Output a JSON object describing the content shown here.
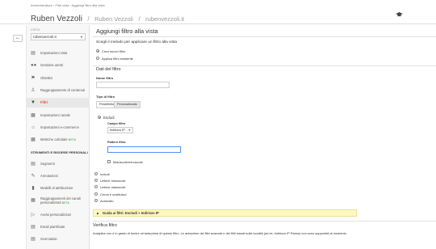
{
  "header": {
    "breadcrumb": "Amministratore › Filtri vista › Aggiungi filtro alla vista",
    "title": "Ruben Vezzoli",
    "subtitle_a": "Ruben Vezzoli",
    "subtitle_b": "rubenvezzoli.it"
  },
  "sidebar": {
    "vista_label": "VISTA",
    "vista_value": "rubenvezzoli.it",
    "section_personal": "STRUMENTI E RISORSE PERSONALI",
    "items": [
      {
        "label": "Impostazioni vista",
        "icon": "document-icon"
      },
      {
        "label": "Gestione utenti",
        "icon": "users-icon"
      },
      {
        "label": "Obiettivi",
        "icon": "flag-icon"
      },
      {
        "label": "Raggruppamento di contenuti",
        "icon": "person-icon"
      },
      {
        "label": "Filtri",
        "icon": "filter-icon"
      },
      {
        "label": "Impostazioni canale",
        "icon": "channel-icon"
      },
      {
        "label": "Impostazioni e-commerce",
        "icon": "cart-icon"
      },
      {
        "label": "Metriche calcolate",
        "badge": "BETA",
        "icon": "calc-icon"
      },
      {
        "label": "Segmenti",
        "icon": "segments-icon"
      },
      {
        "label": "Annotazioni",
        "icon": "annotation-icon"
      },
      {
        "label": "Modelli di attribuzione",
        "icon": "bars-icon"
      },
      {
        "label": "Raggruppamenti dei canali",
        "label2": "personalizzati",
        "badge": "BETA",
        "icon": "grid-icon"
      },
      {
        "label": "Avvisi personalizzati",
        "icon": "megaphone-icon"
      },
      {
        "label": "Email pianificate",
        "icon": "calendar-icon"
      },
      {
        "label": "Scorciatoie",
        "icon": "shortcut-icon"
      }
    ]
  },
  "main": {
    "title": "Aggiungi filtro alla vista",
    "method_prompt": "Scegli il metodo per applicare un filtro alla vista",
    "method_new": "Crea nuovo filtro",
    "method_existing": "Applica filtro esistente",
    "details_title": "Dati del filtro",
    "name_label": "Nome filtro",
    "name_value": "",
    "type_label": "Tipo di filtro",
    "type_predefined": "Predefinito",
    "type_custom": "Personalizzato",
    "exclude_label": "Escludi",
    "field_label": "Campo filtro",
    "field_value": "Indirizzo IP",
    "pattern_label": "Pattern filtro",
    "pattern_value": "",
    "case_label": "Maiuscole/minuscole",
    "options": [
      "Includi",
      "Lettere minuscole",
      "Lettere maiuscole",
      "Cerca e sostituisci",
      "Avanzato"
    ],
    "guide_prefix": "Guida ai filtri:",
    "guide_path": "Escludi > Indirizzo IP",
    "verify_title": "Verifica filtro",
    "verify_text": "Analytics non è in grado di fornire un'anteprima di questo filtro. Le anteprime dei filtri avanzati e dei filtri basati sulla località (ad es. indirizzo IP Paese) non sono supportati al momento."
  }
}
